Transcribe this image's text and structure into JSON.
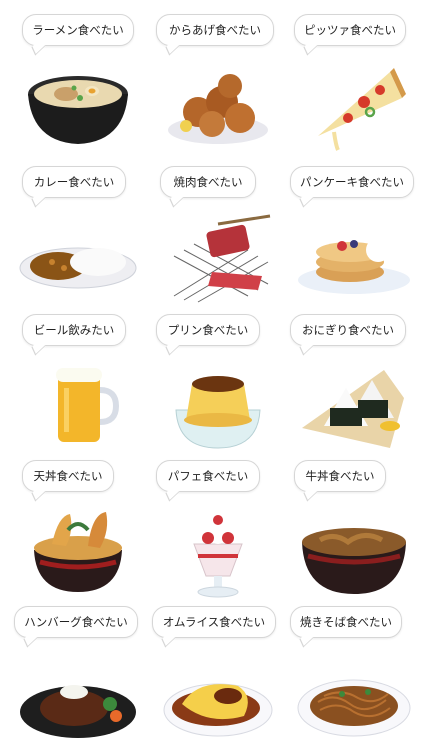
{
  "stickers": [
    {
      "label": "ラーメン食べたい",
      "icon": "ramen-icon"
    },
    {
      "label": "からあげ食べたい",
      "icon": "karaage-icon"
    },
    {
      "label": "ピッツァ食べたい",
      "icon": "pizza-icon"
    },
    {
      "label": "カレー食べたい",
      "icon": "curry-icon"
    },
    {
      "label": "焼肉食べたい",
      "icon": "yakiniku-icon"
    },
    {
      "label": "パンケーキ食べたい",
      "icon": "pancake-icon"
    },
    {
      "label": "ビール飲みたい",
      "icon": "beer-icon"
    },
    {
      "label": "プリン食べたい",
      "icon": "pudding-icon"
    },
    {
      "label": "おにぎり食べたい",
      "icon": "onigiri-icon"
    },
    {
      "label": "天丼食べたい",
      "icon": "tendon-icon"
    },
    {
      "label": "パフェ食べたい",
      "icon": "parfait-icon"
    },
    {
      "label": "牛丼食べたい",
      "icon": "gyudon-icon"
    },
    {
      "label": "ハンバーグ食べたい",
      "icon": "hamburg-icon"
    },
    {
      "label": "オムライス食べたい",
      "icon": "omurice-icon"
    },
    {
      "label": "焼きそば食べたい",
      "icon": "yakisoba-icon"
    }
  ]
}
